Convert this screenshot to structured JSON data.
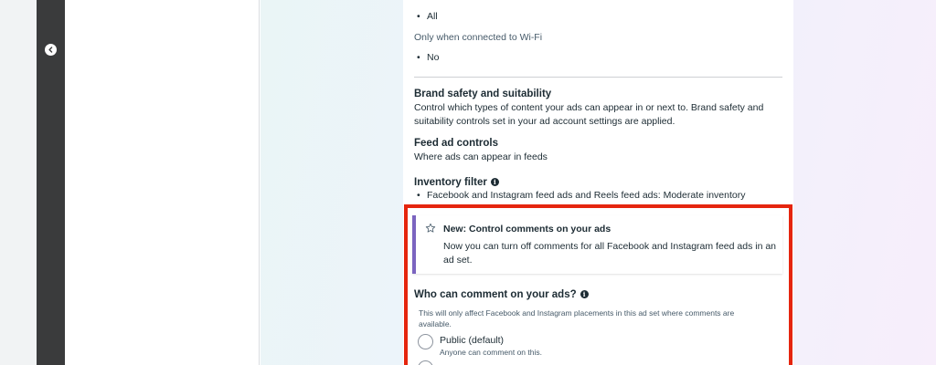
{
  "connection_types": {
    "all_value": "All",
    "wifi_label": "Only when connected to Wi-Fi",
    "wifi_value": "No"
  },
  "brand_safety": {
    "title": "Brand safety and suitability",
    "description": "Control which types of content your ads can appear in or next to. Brand safety and suitability controls set in your ad account settings are applied."
  },
  "feed_ad_controls": {
    "title": "Feed ad controls",
    "description": "Where ads can appear in feeds"
  },
  "inventory_filter": {
    "title": "Inventory filter",
    "value": "Facebook and Instagram feed ads and Reels feed ads: Moderate inventory"
  },
  "notice": {
    "title": "New: Control comments on your ads",
    "body": "Now you can turn off comments for all Facebook and Instagram feed ads in an ad set."
  },
  "comments": {
    "question": "Who can comment on your ads?",
    "helper": "This will only affect Facebook and Instagram placements in this ad set where comments are available.",
    "options": [
      {
        "label": "Public (default)",
        "description": "Anyone can comment on this."
      }
    ]
  },
  "colors": {
    "highlight_border": "#e5250e",
    "notice_accent": "#7b64c0",
    "rail": "#3a3b3c"
  }
}
